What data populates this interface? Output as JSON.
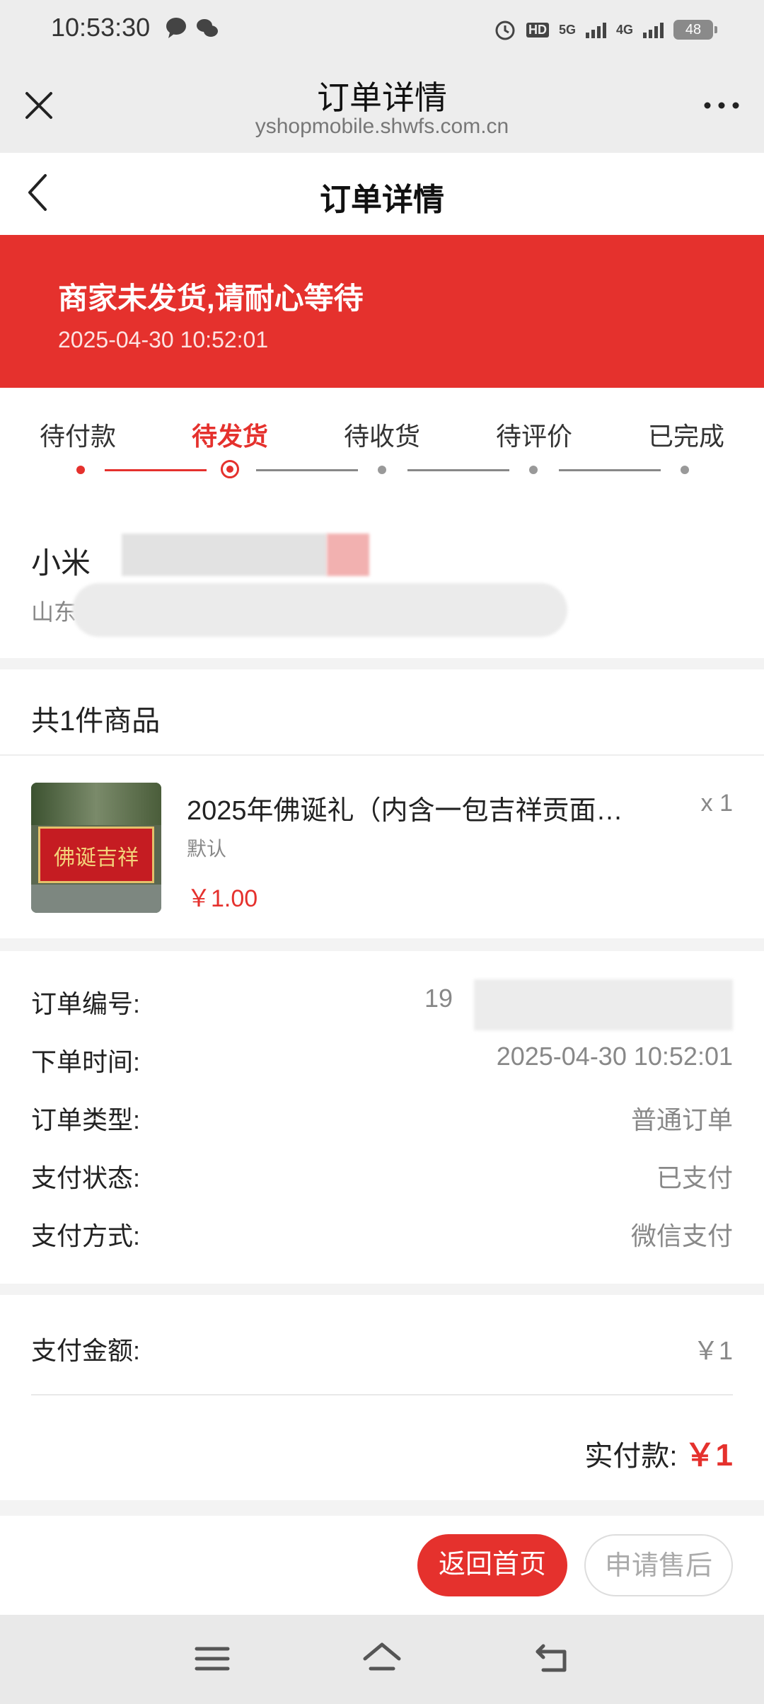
{
  "status_bar": {
    "time": "10:53:30",
    "hd_label": "HD",
    "net1": "5G",
    "net2": "4G",
    "battery": "48"
  },
  "webview": {
    "title": "订单详情",
    "url": "yshopmobile.shwfs.com.cn"
  },
  "header": {
    "title": "订单详情"
  },
  "banner": {
    "message": "商家未发货,请耐心等待",
    "time": "2025-04-30 10:52:01"
  },
  "steps": [
    "待付款",
    "待发货",
    "待收货",
    "待评价",
    "已完成"
  ],
  "active_step": 1,
  "address": {
    "name": "小米",
    "address": "山东"
  },
  "goods": {
    "count_label": "共1件商品",
    "items": [
      {
        "name": "2025年佛诞礼（内含一包吉祥贡面…",
        "spec": "默认",
        "price": "￥1.00",
        "qty": "x 1",
        "thumb_text": "佛诞吉祥"
      }
    ]
  },
  "order_info": [
    {
      "label": "订单编号:",
      "value": "19"
    },
    {
      "label": "下单时间:",
      "value": "2025-04-30 10:52:01"
    },
    {
      "label": "订单类型:",
      "value": "普通订单"
    },
    {
      "label": "支付状态:",
      "value": "已支付"
    },
    {
      "label": "支付方式:",
      "value": "微信支付"
    }
  ],
  "payment": {
    "amount_label": "支付金额:",
    "amount_value": "￥1",
    "total_label": "实付款:",
    "total_value": "￥1"
  },
  "actions": {
    "home": "返回首页",
    "after_sale": "申请售后"
  },
  "colors": {
    "accent": "#e5312d"
  }
}
